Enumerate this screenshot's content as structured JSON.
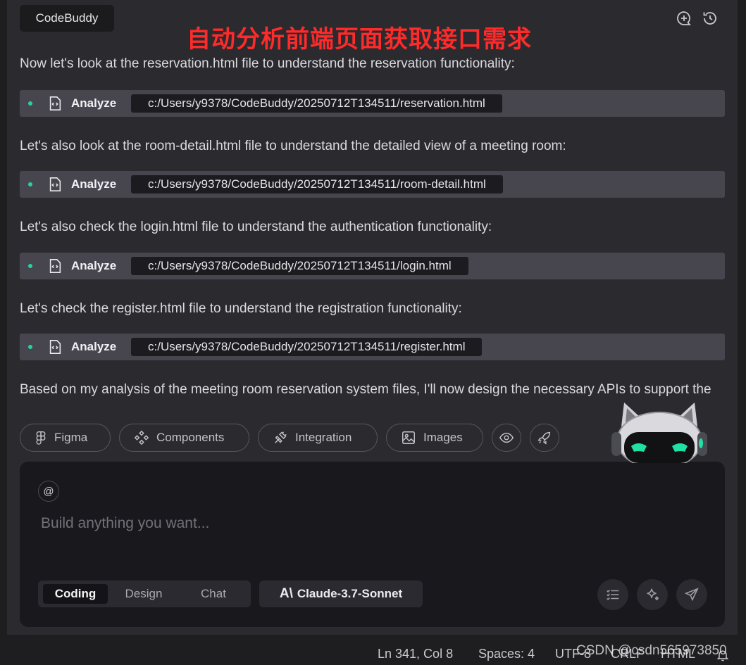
{
  "header": {
    "brand": "CodeBuddy",
    "overlay_title": "自动分析前端页面获取接口需求",
    "icons": [
      "add-chat-icon",
      "history-icon"
    ]
  },
  "messages": [
    "Now let's look at the reservation.html file to understand the reservation functionality:",
    "Let's also look at the room-detail.html file to understand the detailed view of a meeting room:",
    "Let's also check the login.html file to understand the authentication functionality:",
    "Let's check the register.html file to understand the registration functionality:",
    "Based on my analysis of the meeting room reservation system files, I'll now design the necessary APIs to support the"
  ],
  "analyze_rows": [
    {
      "label": "Analyze",
      "path": "c:/Users/y9378/CodeBuddy/20250712T134511/reservation.html"
    },
    {
      "label": "Analyze",
      "path": "c:/Users/y9378/CodeBuddy/20250712T134511/room-detail.html"
    },
    {
      "label": "Analyze",
      "path": "c:/Users/y9378/CodeBuddy/20250712T134511/login.html"
    },
    {
      "label": "Analyze",
      "path": "c:/Users/y9378/CodeBuddy/20250712T134511/register.html"
    }
  ],
  "chips": [
    {
      "label": "Figma",
      "icon": "figma-icon"
    },
    {
      "label": "Components",
      "icon": "components-icon"
    },
    {
      "label": "Integration",
      "icon": "plug-icon"
    },
    {
      "label": "Images",
      "icon": "image-icon"
    }
  ],
  "chip_icons": [
    "eye-icon",
    "rocket-icon"
  ],
  "composer": {
    "at_symbol": "@",
    "placeholder": "Build anything you want...",
    "modes": [
      "Coding",
      "Design",
      "Chat"
    ],
    "active_mode": "Coding",
    "model_mark": "A\\",
    "model": "Claude-3.7-Sonnet"
  },
  "statusbar": {
    "position": "Ln 341, Col 8",
    "spaces": "Spaces: 4",
    "encoding": "UTF-8",
    "eol": "CRLF",
    "language": "HTML"
  },
  "watermark": "CSDN @csdn565973850",
  "colors": {
    "accent_green": "#26d3a0",
    "title_red": "#ff2a2a",
    "panel": "#2b2b2f"
  }
}
